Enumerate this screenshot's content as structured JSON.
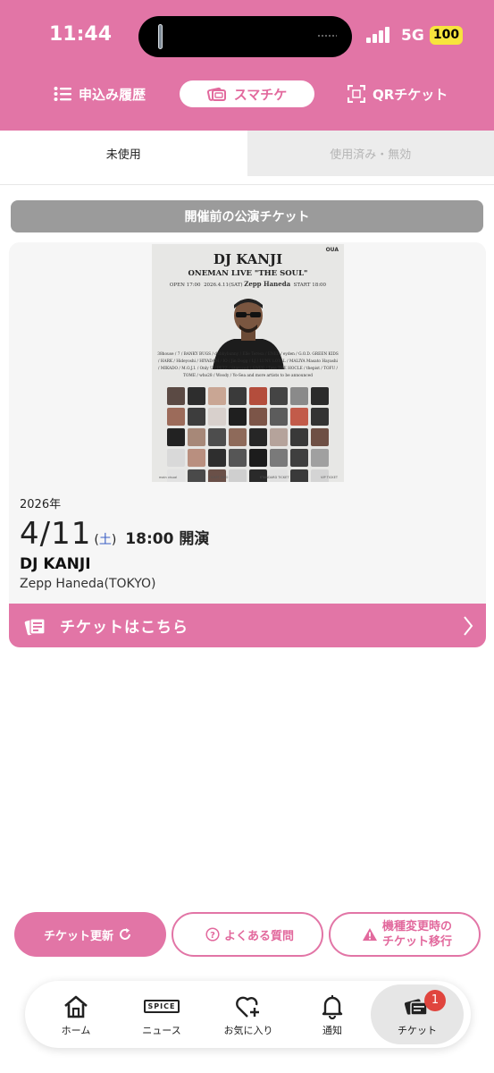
{
  "status_bar": {
    "time": "11:44",
    "network": "5G",
    "battery": "100"
  },
  "header": {
    "tabs": [
      {
        "label": "申込み履歴",
        "icon": "list-icon"
      },
      {
        "label": "スマチケ",
        "icon": "smart-ticket-icon",
        "active": true
      },
      {
        "label": "QRチケット",
        "icon": "qr-scan-icon"
      }
    ]
  },
  "usage_tabs": {
    "unused": "未使用",
    "used": "使用済み・無効"
  },
  "section_label": "開催前の公演チケット",
  "ticket": {
    "poster": {
      "logo": "OUA",
      "title": "DJ KANJI",
      "subtitle": "ONEMAN LIVE \"THE SOUL\"",
      "info_left": "OPEN 17:00",
      "info_date": "2026.4.11",
      "info_dow": "(SAT)",
      "info_venue": "Zepp Haneda",
      "info_right": "START 18:00",
      "guests": "38house / 7 / BANKY BUGS / dubbybunny / Elle Teresa / ENEL / eyden / G.O.D. GREEN KIDS / HARK / Hideyoshi / HIYADAM / IO / Jin Dogg / LJ / LUNV LOYAL / MALIYA Masato Hayashi / MIKADO / M.O.J.I. / Only U / PETZ / Starcced / SWEE / Tete THE HOCLE / thepist / TOFU / TOME / who28 / Woody / Yo-Sea and more artists to be announced",
      "footer_items": [
        "main visual",
        "TICKET INFO",
        "STANDARD TICKET",
        "VIP TICKET"
      ]
    },
    "year": "2026年",
    "month_day": "4/11",
    "dow_open": "(",
    "dow": "土",
    "dow_close": ")",
    "time": "18:00 開演",
    "artist": "DJ KANJI",
    "venue": "Zepp Haneda(TOKYO)",
    "link_label": "チケットはこちら"
  },
  "actions": {
    "refresh": "チケット更新",
    "faq": "よくある質問",
    "transfer_line1": "機種変更時の",
    "transfer_line2": "チケット移行"
  },
  "tabbar": {
    "home": "ホーム",
    "news": "ニュース",
    "news_logo": "SPICE",
    "favorites": "お気に入り",
    "notifications": "通知",
    "tickets": "チケット",
    "tickets_badge": "1"
  },
  "colors": {
    "brand_pink": "#e275a6",
    "badge_red": "#e0453e",
    "saturday_blue": "#3b5fc4"
  }
}
